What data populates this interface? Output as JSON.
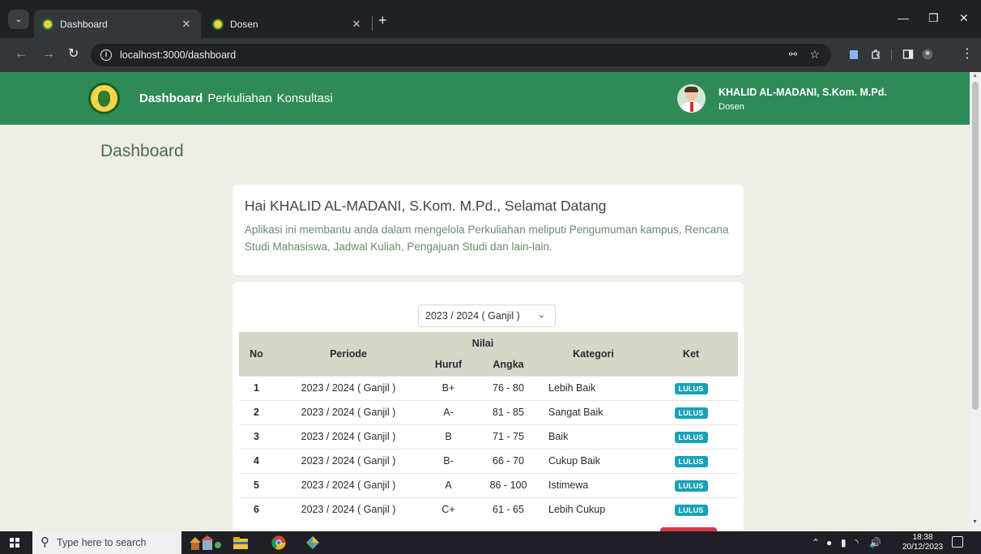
{
  "browser": {
    "tabs": [
      {
        "title": "Dashboard",
        "active": true
      },
      {
        "title": "Dosen",
        "active": false
      }
    ],
    "url": "localhost:3000/dashboard"
  },
  "header": {
    "nav": [
      "Dashboard",
      "Perkuliahan",
      "Konsultasi"
    ],
    "user_name": "KHALID AL-MADANI, S.Kom. M.Pd.",
    "user_role": "Dosen"
  },
  "page": {
    "title": "Dashboard",
    "welcome_title": "Hai KHALID AL-MADANI, S.Kom. M.Pd., Selamat Datang",
    "welcome_text": "Aplikasi ini membantu anda dalam mengelola Perkuliahan meliputi Pengumuman kampus, Rencana Studi Mahasiswa, Jadwal Kuliah, Pengajuan Studi dan lain-lain.",
    "period_select": "2023 / 2024 ( Ganjil )"
  },
  "table": {
    "headers": {
      "no": "No",
      "periode": "Periode",
      "nilai": "Nilai",
      "huruf": "Huruf",
      "angka": "Angka",
      "kategori": "Kategori",
      "ket": "Ket"
    },
    "rows": [
      {
        "no": "1",
        "periode": "2023 / 2024 ( Ganjil )",
        "huruf": "B+",
        "angka": "76 - 80",
        "kategori": "Lebih Baik",
        "ket": "LULUS"
      },
      {
        "no": "2",
        "periode": "2023 / 2024 ( Ganjil )",
        "huruf": "A-",
        "angka": "81 - 85",
        "kategori": "Sangat Baik",
        "ket": "LULUS"
      },
      {
        "no": "3",
        "periode": "2023 / 2024 ( Ganjil )",
        "huruf": "B",
        "angka": "71 - 75",
        "kategori": "Baik",
        "ket": "LULUS"
      },
      {
        "no": "4",
        "periode": "2023 / 2024 ( Ganjil )",
        "huruf": "B-",
        "angka": "66 - 70",
        "kategori": "Cukup Baik",
        "ket": "LULUS"
      },
      {
        "no": "5",
        "periode": "2023 / 2024 ( Ganjil )",
        "huruf": "A",
        "angka": "86 - 100",
        "kategori": "Istimewa",
        "ket": "LULUS"
      },
      {
        "no": "6",
        "periode": "2023 / 2024 ( Ganjil )",
        "huruf": "C+",
        "angka": "61 - 65",
        "kategori": "Lebih Cukup",
        "ket": "LULUS"
      }
    ]
  },
  "taskbar": {
    "search_placeholder": "Type here to search",
    "time": "18:38",
    "date": "20/12/2023"
  },
  "colors": {
    "header_green": "#2e8b57",
    "badge_teal": "#17a2b8",
    "badge_red": "#dc3545",
    "page_bg": "#eef0e8"
  }
}
